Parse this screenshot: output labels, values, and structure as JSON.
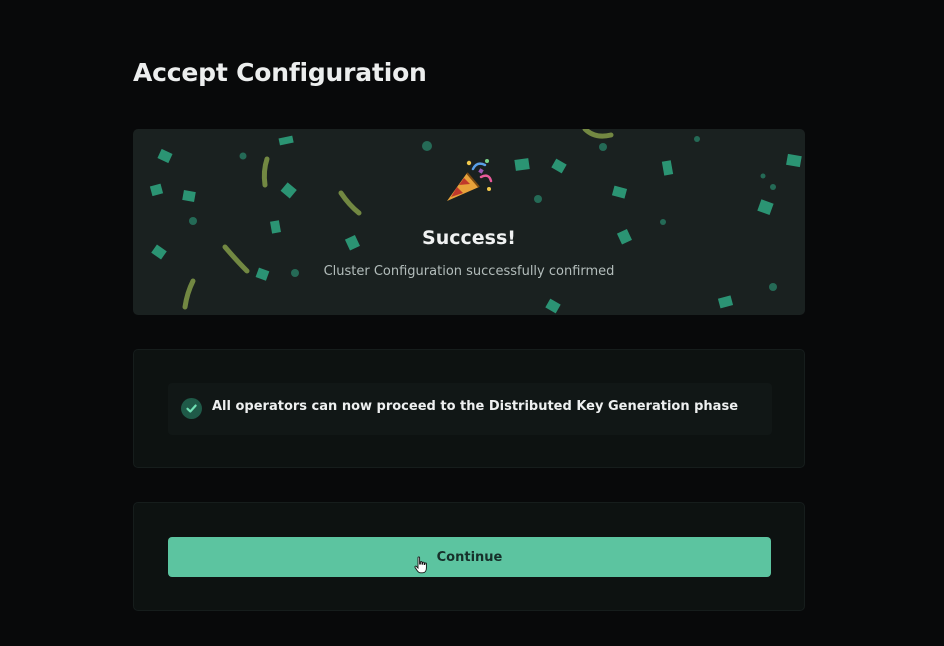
{
  "page": {
    "title": "Accept Configuration"
  },
  "success": {
    "icon": "party-popper-icon",
    "title": "Success!",
    "message": "Cluster Configuration successfully confirmed"
  },
  "notice": {
    "icon": "check-circle-icon",
    "text": "All operators can now proceed to the Distributed Key Generation phase"
  },
  "actions": {
    "continue_label": "Continue"
  },
  "colors": {
    "background": "#08090a",
    "card": "#1a2120",
    "accent": "#5cc4a0",
    "confetti_green": "#2fa883",
    "confetti_olive": "#7d9446"
  }
}
